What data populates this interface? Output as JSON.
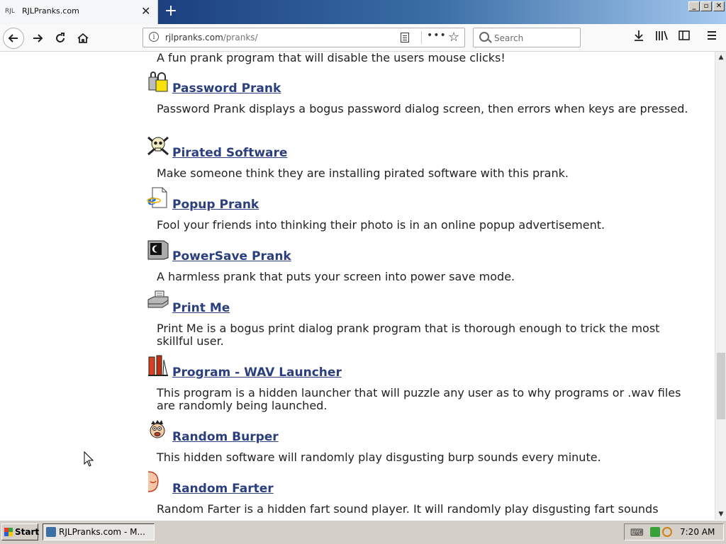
{
  "browser": {
    "tab": {
      "favicon_text": "RJL",
      "title": "RJLPranks.com",
      "close": "✕"
    },
    "new_tab": "+",
    "url": {
      "host": "rjlpranks.com",
      "path": "/pranks/"
    },
    "search_placeholder": "Search",
    "window_buttons": [
      "_",
      "▫",
      "✕"
    ]
  },
  "pranks": [
    {
      "name": "",
      "desc": "A fun prank program that will disable the users mouse clicks!",
      "icon": "mouse-icon"
    },
    {
      "name": "Password Prank",
      "desc": "Password Prank displays a bogus password dialog screen, then errors when keys are pressed.",
      "icon": "padlock-icon"
    },
    {
      "name": "Pirated Software",
      "desc": "Make someone think they are installing pirated software with this prank.",
      "icon": "skull-crossbones-icon"
    },
    {
      "name": "Popup Prank",
      "desc": "Fool your friends into thinking their photo is in an online popup advertisement.",
      "icon": "internet-explorer-page-icon"
    },
    {
      "name": "PowerSave Prank",
      "desc": "A harmless prank that puts your screen into power save mode.",
      "icon": "monitor-icon"
    },
    {
      "name": "Print Me",
      "desc": "Print Me is a bogus print dialog prank program that is thorough enough to trick the most skillful user.",
      "icon": "printer-icon"
    },
    {
      "name": "Program - WAV Launcher",
      "desc": "This program is a hidden launcher that will puzzle any user as to why programs or .wav files are randomly being launched.",
      "icon": "launcher-icon"
    },
    {
      "name": "Random Burper",
      "desc": "This hidden software will randomly play disgusting burp sounds every minute.",
      "icon": "cartoon-face-icon"
    },
    {
      "name": "Random Farter",
      "desc": "Random Farter is a hidden fart sound player. It will randomly play disgusting fart sounds",
      "icon": "cartoon-bottom-icon"
    }
  ],
  "taskbar": {
    "start_label": "Start",
    "task_label": "RJLPranks.com - M...",
    "clock": "7:20 AM"
  }
}
